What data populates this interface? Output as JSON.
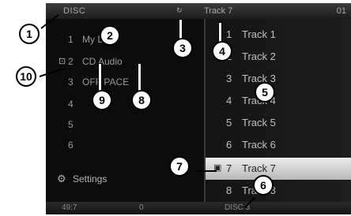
{
  "topbar": {
    "source": "DISC",
    "track": "Track 7",
    "number": "01",
    "icon": "repeat-icon"
  },
  "menu": {
    "rows": [
      {
        "n": "1",
        "label": "My Disc"
      },
      {
        "n": "2",
        "label": "CD Audio",
        "icon": "cd-icon"
      },
      {
        "n": "3",
        "label": "OFF PACE"
      },
      {
        "n": "4",
        "label": ""
      },
      {
        "n": "5",
        "label": ""
      },
      {
        "n": "6",
        "label": ""
      }
    ],
    "settings": "Settings"
  },
  "tracks": [
    {
      "n": "1",
      "title": "Track 1"
    },
    {
      "n": "2",
      "title": "Track 2"
    },
    {
      "n": "3",
      "title": "Track 3"
    },
    {
      "n": "4",
      "title": "Track 4"
    },
    {
      "n": "5",
      "title": "Track 5"
    },
    {
      "n": "6",
      "title": "Track 6"
    },
    {
      "n": "7",
      "title": "Track 7",
      "selected": true
    },
    {
      "n": "8",
      "title": "Track 8"
    }
  ],
  "bottombar": {
    "left": "49:7",
    "middle": "0",
    "right": "DISC 3"
  },
  "callouts": [
    "1",
    "2",
    "3",
    "4",
    "5",
    "6",
    "7",
    "8",
    "9",
    "10"
  ]
}
